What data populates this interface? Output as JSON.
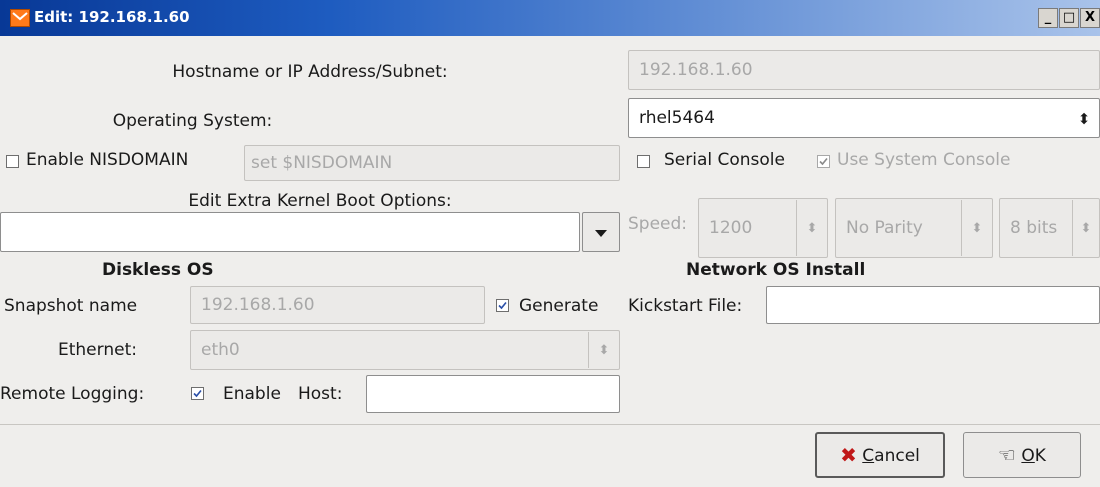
{
  "window": {
    "title": "Edit: 192.168.1.60",
    "controls": [
      "_",
      "□",
      "X"
    ]
  },
  "host": {
    "label": "Hostname or IP Address/Subnet:",
    "value": "192.168.1.60"
  },
  "os": {
    "label": "Operating System:",
    "selected": "rhel5464"
  },
  "nis": {
    "checkbox_label": "Enable NISDOMAIN",
    "checked": false,
    "placeholder": "set $NISDOMAIN"
  },
  "serial": {
    "checkbox_label": "Serial Console",
    "checked": false,
    "system_console_label": "Use System Console",
    "system_console_checked": true,
    "speed_label": "Speed:",
    "speed_value": "1200",
    "parity_value": "No Parity",
    "bits_value": "8 bits"
  },
  "kernel": {
    "label": "Edit Extra Kernel Boot Options:",
    "value": ""
  },
  "diskless": {
    "heading": "Diskless OS",
    "snapshot_label": "Snapshot name",
    "snapshot_value": "192.168.1.60",
    "generate_label": "Generate",
    "generate_checked": true,
    "ethernet_label": "Ethernet:",
    "ethernet_value": "eth0",
    "remote_logging_label": "Remote Logging:",
    "remote_logging_enable_label": "Enable",
    "remote_logging_checked": true,
    "host_label": "Host:",
    "host_value": ""
  },
  "network_install": {
    "heading": "Network OS Install",
    "kickstart_label": "Kickstart File:",
    "kickstart_value": ""
  },
  "buttons": {
    "cancel_prefix": "",
    "cancel_accel": "C",
    "cancel_rest": "ancel",
    "ok_accel": "O",
    "ok_rest": "K"
  },
  "colors": {
    "titlebar_start": "#083896",
    "titlebar_end": "#a9c3ea",
    "dialog_bg": "#efeeec",
    "cancel_icon": "#c01818",
    "disabled_text": "#a8a8a8"
  },
  "icons": {
    "app": "app-icon",
    "cancel": "cancel-x-icon",
    "ok": "ok-hand-icon",
    "dropdown": "chevron-down-icon",
    "spinner": "updown-icon"
  }
}
